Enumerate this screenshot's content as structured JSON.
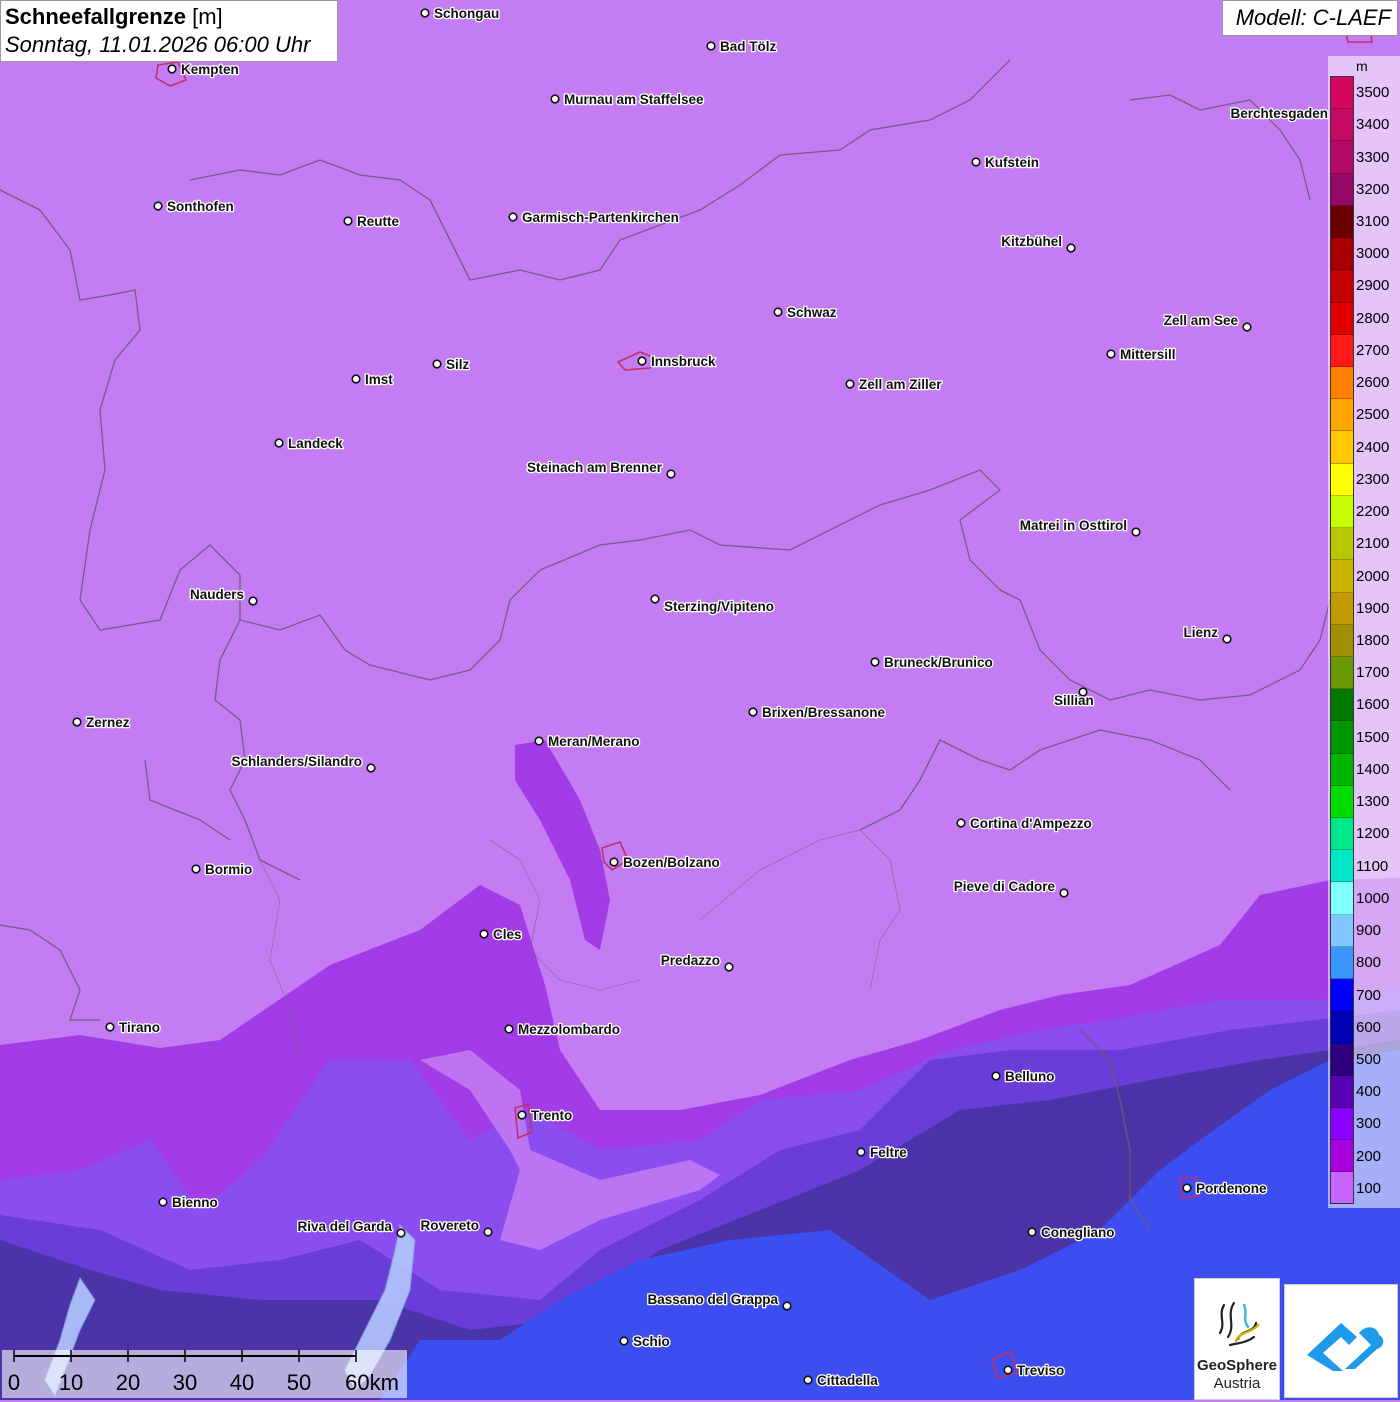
{
  "header": {
    "title": "Schneefallgrenze",
    "unit": "[m]",
    "datetime": "Sonntag, 11.01.2026 06:00 Uhr",
    "model": "Modell: C-LAEF"
  },
  "legend": {
    "unit": "m",
    "values": [
      "3500",
      "3400",
      "3300",
      "3200",
      "3100",
      "3000",
      "2900",
      "2800",
      "2700",
      "2600",
      "2500",
      "2400",
      "2300",
      "2200",
      "2100",
      "2000",
      "1900",
      "1800",
      "1700",
      "1600",
      "1500",
      "1400",
      "1300",
      "1200",
      "1100",
      "1000",
      "900",
      "800",
      "700",
      "600",
      "500",
      "400",
      "300",
      "200",
      "100"
    ],
    "colors": [
      "#d4085e",
      "#c40a62",
      "#b20a66",
      "#98086a",
      "#6a0000",
      "#a80000",
      "#c40000",
      "#e00000",
      "#ff1a1a",
      "#ff7f00",
      "#ffa500",
      "#ffc800",
      "#ffff00",
      "#c8ff00",
      "#b8c800",
      "#c8b400",
      "#c39a00",
      "#a09000",
      "#6a9a00",
      "#007800",
      "#009600",
      "#00b400",
      "#00dc00",
      "#00e68a",
      "#00e6c8",
      "#80ffff",
      "#80c8ff",
      "#3c96ff",
      "#0000ff",
      "#0000b4",
      "#2c0080",
      "#5a00b4",
      "#8a00ff",
      "#a800dc",
      "#c864ff"
    ]
  },
  "cities": [
    {
      "name": "Schongau"
    },
    {
      "name": "Kempten"
    },
    {
      "name": "Bad Tölz"
    },
    {
      "name": "Murnau am Staffelsee"
    },
    {
      "name": "Berchtesgaden"
    },
    {
      "name": "Kufstein"
    },
    {
      "name": "Sonthofen"
    },
    {
      "name": "Reutte"
    },
    {
      "name": "Garmisch-Partenkirchen"
    },
    {
      "name": "Kitzbühel"
    },
    {
      "name": "Schwaz"
    },
    {
      "name": "Zell am See"
    },
    {
      "name": "Innsbruck"
    },
    {
      "name": "Mittersill"
    },
    {
      "name": "Imst"
    },
    {
      "name": "Silz"
    },
    {
      "name": "Zell am Ziller"
    },
    {
      "name": "Landeck"
    },
    {
      "name": "Steinach am Brenner"
    },
    {
      "name": "Matrei in Osttirol"
    },
    {
      "name": "Nauders"
    },
    {
      "name": "Sterzing/Vipiteno"
    },
    {
      "name": "Lienz"
    },
    {
      "name": "Bruneck/Brunico"
    },
    {
      "name": "Sillian"
    },
    {
      "name": "Zernez"
    },
    {
      "name": "Brixen/Bressanone"
    },
    {
      "name": "Meran/Merano"
    },
    {
      "name": "Schlanders/Silandro"
    },
    {
      "name": "Cortina d'Ampezzo"
    },
    {
      "name": "Bozen/Bolzano"
    },
    {
      "name": "Bormio"
    },
    {
      "name": "Pieve di Cadore"
    },
    {
      "name": "Cles"
    },
    {
      "name": "Predazzo"
    },
    {
      "name": "Tirano"
    },
    {
      "name": "Mezzolombardo"
    },
    {
      "name": "Belluno"
    },
    {
      "name": "Trento"
    },
    {
      "name": "Feltre"
    },
    {
      "name": "Pordenone"
    },
    {
      "name": "Bienno"
    },
    {
      "name": "Riva del Garda"
    },
    {
      "name": "Rovereto"
    },
    {
      "name": "Conegliano"
    },
    {
      "name": "Bassano del Grappa"
    },
    {
      "name": "Schio"
    },
    {
      "name": "Treviso"
    },
    {
      "name": "Cittadella"
    }
  ],
  "scale": {
    "ticks": [
      "0",
      "10",
      "20",
      "30",
      "40",
      "50",
      "60km"
    ]
  },
  "logos": {
    "geosphere_name": "GeoSphere",
    "geosphere_country": "Austria"
  },
  "colors": {
    "snowline_100": "#c47cf2",
    "snowline_200": "#a23ce6",
    "snowline_300": "#8a4ef0",
    "snowline_400": "#6a3cd8",
    "snowline_500": "#4a34a8",
    "snowline_700": "#3c4ef0",
    "border": "#6e5a7a"
  }
}
